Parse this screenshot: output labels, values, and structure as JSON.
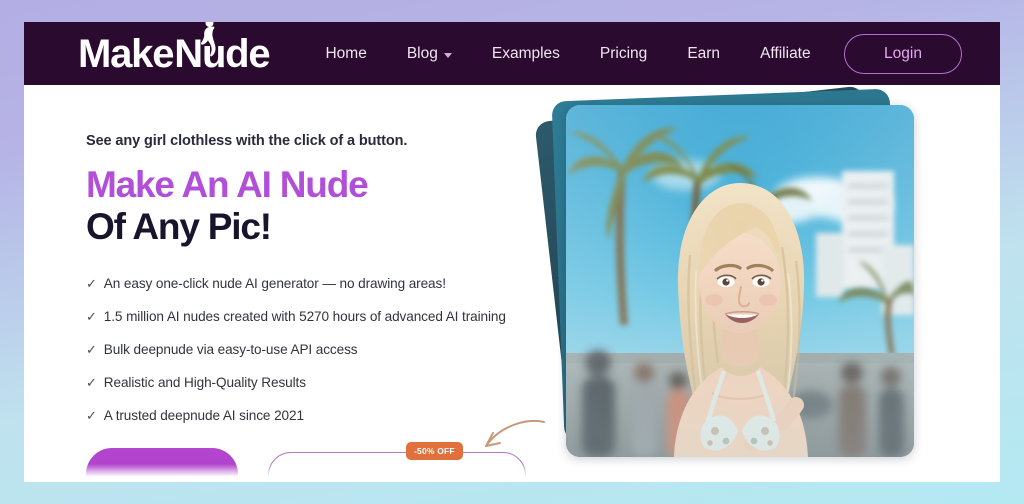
{
  "frame": {
    "gradient_top_color": "#b3aee3",
    "gradient_bottom_color": "#b4e9f2"
  },
  "navbar": {
    "background_color": "#2b0a2f",
    "logo": {
      "text_part1": "Make",
      "text_part2": "Nude",
      "full_text": "MakeNude",
      "icon": "female-silhouette-icon"
    },
    "links": [
      {
        "label": "Home",
        "has_caret": false
      },
      {
        "label": "Blog",
        "has_caret": true
      },
      {
        "label": "Examples",
        "has_caret": false
      },
      {
        "label": "Pricing",
        "has_caret": false
      },
      {
        "label": "Earn",
        "has_caret": false
      },
      {
        "label": "Affiliate",
        "has_caret": false
      }
    ],
    "login_label": "Login",
    "login_border_color": "#b56fd4",
    "login_text_color": "#e3a8f0"
  },
  "hero": {
    "eyebrow": "See any girl clothless with the click of a button.",
    "headline_line1": "Make An AI Nude",
    "headline_line2": "Of Any Pic!",
    "headline_line1_color": "#b14fd8",
    "headline_line2_color": "#17142b",
    "check_glyph": "✓",
    "features": [
      "An easy one-click nude AI generator — no drawing areas!",
      "1.5 million AI nudes created with 5270 hours of advanced AI training",
      "Bulk deepnude via easy-to-use API access",
      "Realistic and High-Quality Results",
      "A trusted deepnude AI since 2021"
    ],
    "cta": {
      "primary_label": "",
      "secondary_label": "",
      "primary_color": "#b445cf",
      "secondary_border_color": "#b07cc4"
    },
    "discount_badge": {
      "label": "-50% OFF",
      "background_color": "#e0703c",
      "text_color": "#ffffff"
    },
    "arrow": "curved-arrow-icon",
    "photo": {
      "alt": "Smiling blonde woman in floral bikini top on a palm-lined beach promenade",
      "stack_count": 3
    }
  }
}
